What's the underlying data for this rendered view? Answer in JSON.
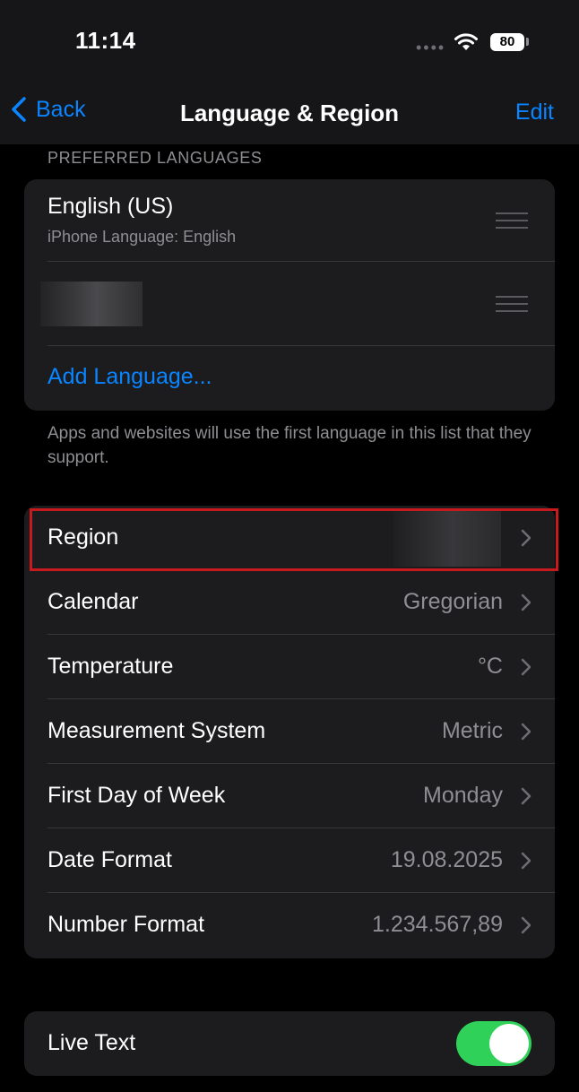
{
  "status_bar": {
    "time": "11:14",
    "battery": "80"
  },
  "nav": {
    "back_label": "Back",
    "title": "Language & Region",
    "edit_label": "Edit"
  },
  "languages": {
    "header": "PREFERRED LANGUAGES",
    "items": [
      {
        "name": "English (US)",
        "subtitle": "iPhone Language: English"
      },
      {
        "name": "",
        "subtitle": ""
      }
    ],
    "add_label": "Add Language...",
    "footer": "Apps and websites will use the first language in this list that they support."
  },
  "settings": {
    "rows": [
      {
        "label": "Region",
        "value": ""
      },
      {
        "label": "Calendar",
        "value": "Gregorian"
      },
      {
        "label": "Temperature",
        "value": "°C"
      },
      {
        "label": "Measurement System",
        "value": "Metric"
      },
      {
        "label": "First Day of Week",
        "value": "Monday"
      },
      {
        "label": "Date Format",
        "value": "19.08.2025"
      },
      {
        "label": "Number Format",
        "value": "1.234.567,89"
      }
    ]
  },
  "live_text": {
    "label": "Live Text",
    "enabled": true
  },
  "colors": {
    "accent": "#0a84ff",
    "toggle_on": "#30d158",
    "highlight": "#c8191e",
    "group_bg": "#1c1c1e"
  }
}
